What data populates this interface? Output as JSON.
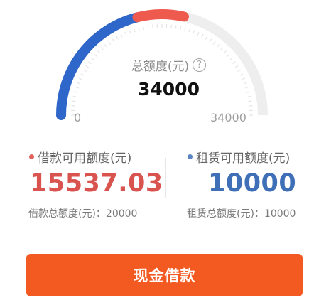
{
  "gauge": {
    "title": "总额度(元)",
    "help_icon": "?",
    "total": "34000",
    "scale_min": "0",
    "scale_max": "34000",
    "used_fraction": 0.57,
    "colors": {
      "track": "#eeeeee",
      "blue": "#2f66c9",
      "red": "#ef5a4f"
    }
  },
  "loan": {
    "label": "借款可用额度(元)",
    "value": "15537.03",
    "total_text": "借款总额度(元)：20000",
    "color": "#d9534f"
  },
  "lease": {
    "label": "租赁可用额度(元)",
    "value": "10000",
    "total_text": "租赁总额度(元)：10000",
    "color": "#3f6fb6"
  },
  "action": {
    "label": "现金借款",
    "color": "#f35a22"
  }
}
